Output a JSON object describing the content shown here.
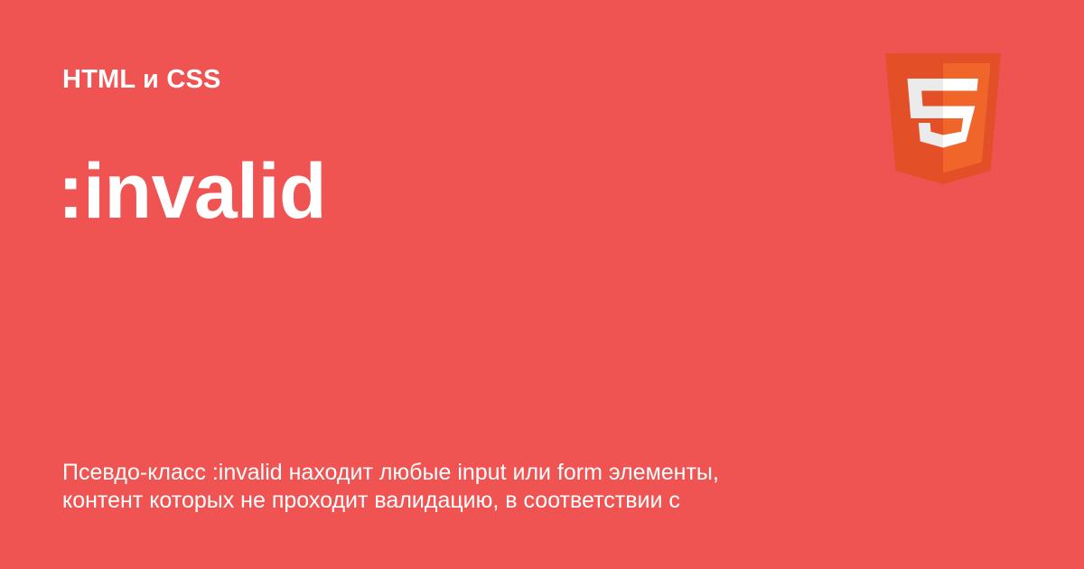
{
  "category": "HTML и CSS",
  "title": ":invalid",
  "description": {
    "lines": [
      "Псевдо-класс :invalid находит любые input или form элементы,",
      "контент которых не проходит валидацию, в соответствии с"
    ]
  },
  "logo": {
    "icon": "html5-shield-icon",
    "glyph": "5"
  },
  "colors": {
    "background": "#EF5453",
    "text": "#FFFFFF",
    "logo_dark": "#E34F26",
    "logo_light": "#F06529",
    "logo_glyph": "#EBEBEB"
  }
}
